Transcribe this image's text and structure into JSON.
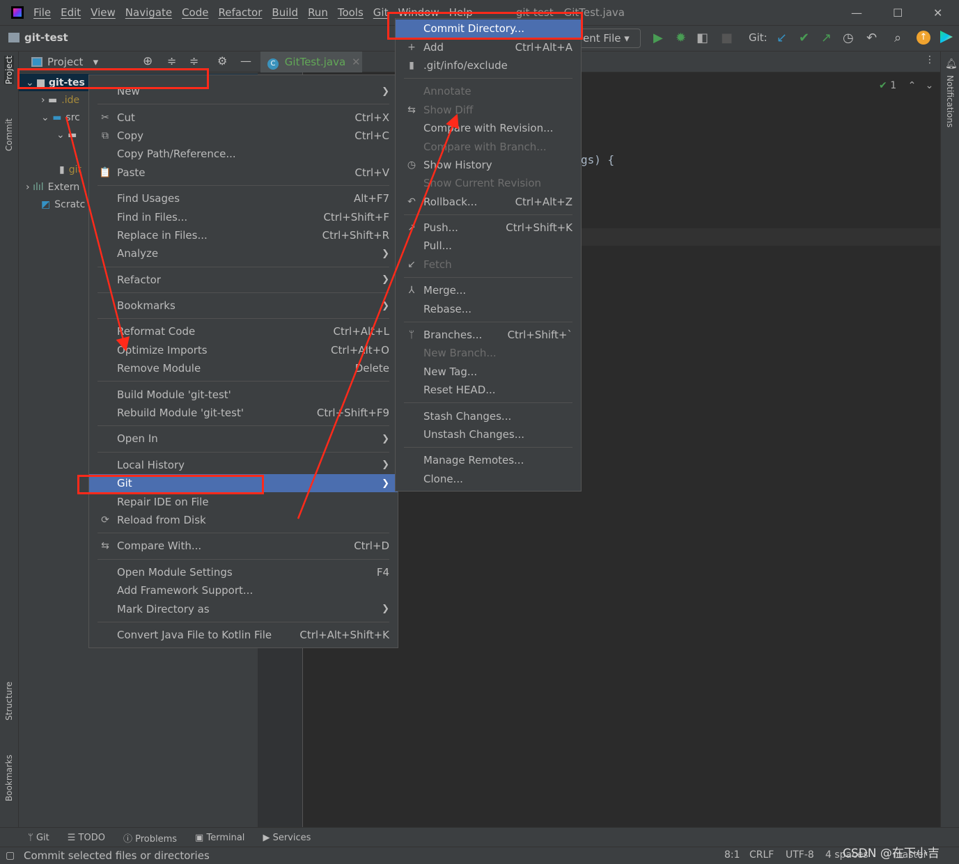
{
  "menubar": {
    "items": [
      "File",
      "Edit",
      "View",
      "Navigate",
      "Code",
      "Refactor",
      "Build",
      "Run",
      "Tools",
      "Git",
      "Window",
      "Help"
    ],
    "title": "git-test - GitTest.java"
  },
  "navbar": {
    "project": "git-test",
    "run_config": "ent File",
    "git_label": "Git:"
  },
  "project_panel": {
    "title": "Project",
    "tree": [
      "git-tes",
      ".ide",
      "src",
      "",
      "git",
      "Extern",
      "Scratc"
    ]
  },
  "editor": {
    "tab": "GitTest.java",
    "code_fragment": "gs) {",
    "inspection_count": "1"
  },
  "sidebar": {
    "left": [
      "Project",
      "Commit",
      "Structure",
      "Bookmarks"
    ],
    "right": [
      "Notifications"
    ]
  },
  "context_menu": [
    {
      "label": "New",
      "arrow": true
    },
    "-",
    {
      "label": "Cut",
      "shortcut": "Ctrl+X",
      "icon": "✂"
    },
    {
      "label": "Copy",
      "shortcut": "Ctrl+C",
      "icon": "⧉"
    },
    {
      "label": "Copy Path/Reference..."
    },
    {
      "label": "Paste",
      "shortcut": "Ctrl+V",
      "icon": "📋"
    },
    "-",
    {
      "label": "Find Usages",
      "shortcut": "Alt+F7"
    },
    {
      "label": "Find in Files...",
      "shortcut": "Ctrl+Shift+F"
    },
    {
      "label": "Replace in Files...",
      "shortcut": "Ctrl+Shift+R"
    },
    {
      "label": "Analyze",
      "arrow": true
    },
    "-",
    {
      "label": "Refactor",
      "arrow": true
    },
    "-",
    {
      "label": "Bookmarks",
      "arrow": true
    },
    "-",
    {
      "label": "Reformat Code",
      "shortcut": "Ctrl+Alt+L"
    },
    {
      "label": "Optimize Imports",
      "shortcut": "Ctrl+Alt+O"
    },
    {
      "label": "Remove Module",
      "shortcut": "Delete"
    },
    "-",
    {
      "label": "Build Module 'git-test'"
    },
    {
      "label": "Rebuild Module 'git-test'",
      "shortcut": "Ctrl+Shift+F9"
    },
    "-",
    {
      "label": "Open In",
      "arrow": true
    },
    "-",
    {
      "label": "Local History",
      "arrow": true
    },
    {
      "label": "Git",
      "arrow": true,
      "highlighted": true
    },
    {
      "label": "Repair IDE on File"
    },
    {
      "label": "Reload from Disk",
      "icon": "⟳"
    },
    "-",
    {
      "label": "Compare With...",
      "shortcut": "Ctrl+D",
      "icon": "⇆"
    },
    "-",
    {
      "label": "Open Module Settings",
      "shortcut": "F4"
    },
    {
      "label": "Add Framework Support..."
    },
    {
      "label": "Mark Directory as",
      "arrow": true
    },
    "-",
    {
      "label": "Convert Java File to Kotlin File",
      "shortcut": "Ctrl+Alt+Shift+K"
    }
  ],
  "git_submenu": [
    {
      "label": "Commit Directory...",
      "highlighted": true
    },
    {
      "label": "Add",
      "shortcut": "Ctrl+Alt+A",
      "icon": "+"
    },
    {
      "label": ".git/info/exclude",
      "icon": "▮"
    },
    "-",
    {
      "label": "Annotate",
      "disabled": true
    },
    {
      "label": "Show Diff",
      "disabled": true,
      "icon": "⇆"
    },
    {
      "label": "Compare with Revision..."
    },
    {
      "label": "Compare with Branch...",
      "disabled": true
    },
    {
      "label": "Show History",
      "icon": "◷"
    },
    {
      "label": "Show Current Revision",
      "disabled": true
    },
    {
      "label": "Rollback...",
      "shortcut": "Ctrl+Alt+Z",
      "icon": "↶"
    },
    "-",
    {
      "label": "Push...",
      "shortcut": "Ctrl+Shift+K",
      "icon": "↗"
    },
    {
      "label": "Pull..."
    },
    {
      "label": "Fetch",
      "disabled": true,
      "icon": "↙"
    },
    "-",
    {
      "label": "Merge...",
      "icon": "⅄"
    },
    {
      "label": "Rebase..."
    },
    "-",
    {
      "label": "Branches...",
      "shortcut": "Ctrl+Shift+`",
      "icon": "ᛘ"
    },
    {
      "label": "New Branch...",
      "disabled": true
    },
    {
      "label": "New Tag..."
    },
    {
      "label": "Reset HEAD..."
    },
    "-",
    {
      "label": "Stash Changes..."
    },
    {
      "label": "Unstash Changes..."
    },
    "-",
    {
      "label": "Manage Remotes..."
    },
    {
      "label": "Clone..."
    }
  ],
  "bottom_tools": [
    "Git",
    "TODO",
    "Problems",
    "Terminal",
    "Services"
  ],
  "status": {
    "message": "Commit selected files or directories",
    "position": "8:1",
    "line_sep": "CRLF",
    "encoding": "UTF-8",
    "indent": "4 spaces",
    "branch": "master",
    "watermark": "CSDN @在下小吉"
  },
  "colors": {
    "highlight": "#4b6eaf",
    "annotation": "#ff2a1a",
    "bg": "#3c3f41",
    "editor": "#2b2b2b"
  }
}
